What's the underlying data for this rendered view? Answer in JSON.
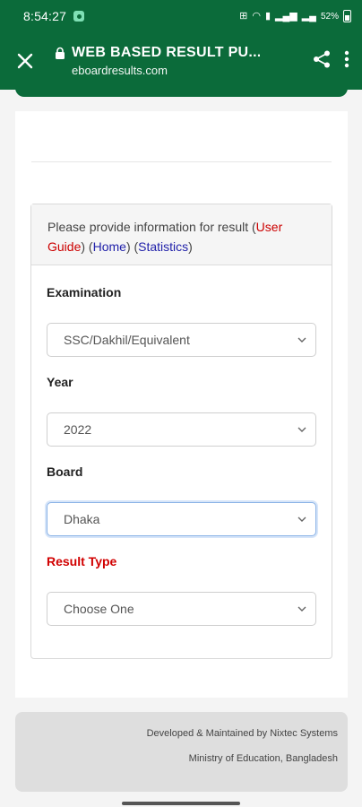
{
  "status_bar": {
    "time": "8:54:27",
    "battery": "52%"
  },
  "browser": {
    "page_title": "WEB BASED RESULT PU...",
    "host": "eboardresults.com",
    "icons": [
      "close-icon",
      "lock-icon",
      "share-icon",
      "more-vert-icon"
    ]
  },
  "panel": {
    "intro_text": "Please provide information for result (",
    "user_guide_link": "User Guide",
    "sep1": ") (",
    "home_link": "Home",
    "sep2": ") (",
    "statistics_link": "Statistics",
    "close_paren": ")"
  },
  "form": {
    "examination_label": "Examination",
    "examination_value": "SSC/Dakhil/Equivalent",
    "year_label": "Year",
    "year_value": "2022",
    "board_label": "Board",
    "board_value": "Dhaka",
    "result_type_label": "Result Type",
    "result_type_value": "Choose One"
  },
  "footer": {
    "line1": "Developed & Maintained by Nixtec Systems",
    "line2": "Ministry of Education, Bangladesh"
  },
  "colors": {
    "brand_green": "#0b6b3a",
    "link_red": "#cc0000",
    "link_blue": "#2222aa"
  }
}
